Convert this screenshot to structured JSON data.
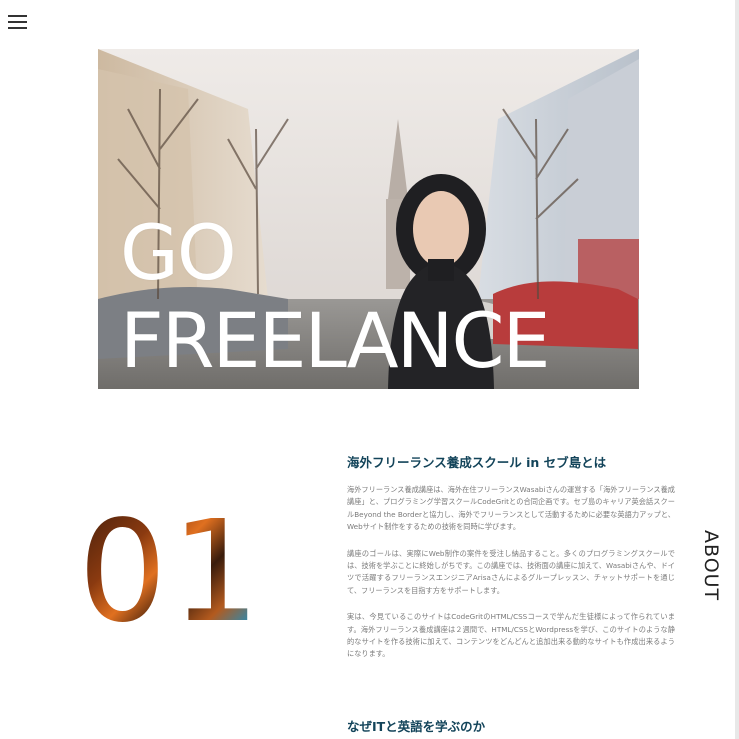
{
  "nav": {
    "menu_icon": "hamburger-icon"
  },
  "hero": {
    "title_line1": "GO",
    "title_line2": "FREELANCE"
  },
  "section_about": {
    "number": "01",
    "side_label": "ABOUT",
    "heading": "海外フリーランス養成スクール in セブ島とは",
    "paragraphs": [
      "海外フリーランス養成講座は、海外在住フリーランスWasabiさんの運営する「海外フリーランス養成講座」と、プログラミング学習スクールCodeGritとの合同企画です。セブ島のキャリア英会話スクールBeyond the Borderと協力し、海外でフリーランスとして活動するために必要な英語力アップと、Webサイト制作をするための技術を同時に学びます。",
      "講座のゴールは、実際にWeb制作の案件を受注し納品すること。多くのプログラミングスクールでは、技術を学ぶことに終始しがちです。この講座では、技術面の講座に加えて、Wasabiさんや、ドイツで活躍するフリーランスエンジニアArisaさんによるグループレッスン、チャットサポートを通じて、フリーランスを目指す方をサポートします。",
      "実は、今見ているこのサイトはCodeGritのHTML/CSSコースで学んだ生徒様によって作られています。海外フリーランス養成講座は２週間で、HTML/CSSとWordpressを学び、このサイトのような静的なサイトを作る技術に加えて、コンテンツをどんどんと追加出来る動的なサイトも作成出来るようになります。"
    ]
  },
  "section_why": {
    "heading": "なぜITと英語を学ぶのか"
  }
}
